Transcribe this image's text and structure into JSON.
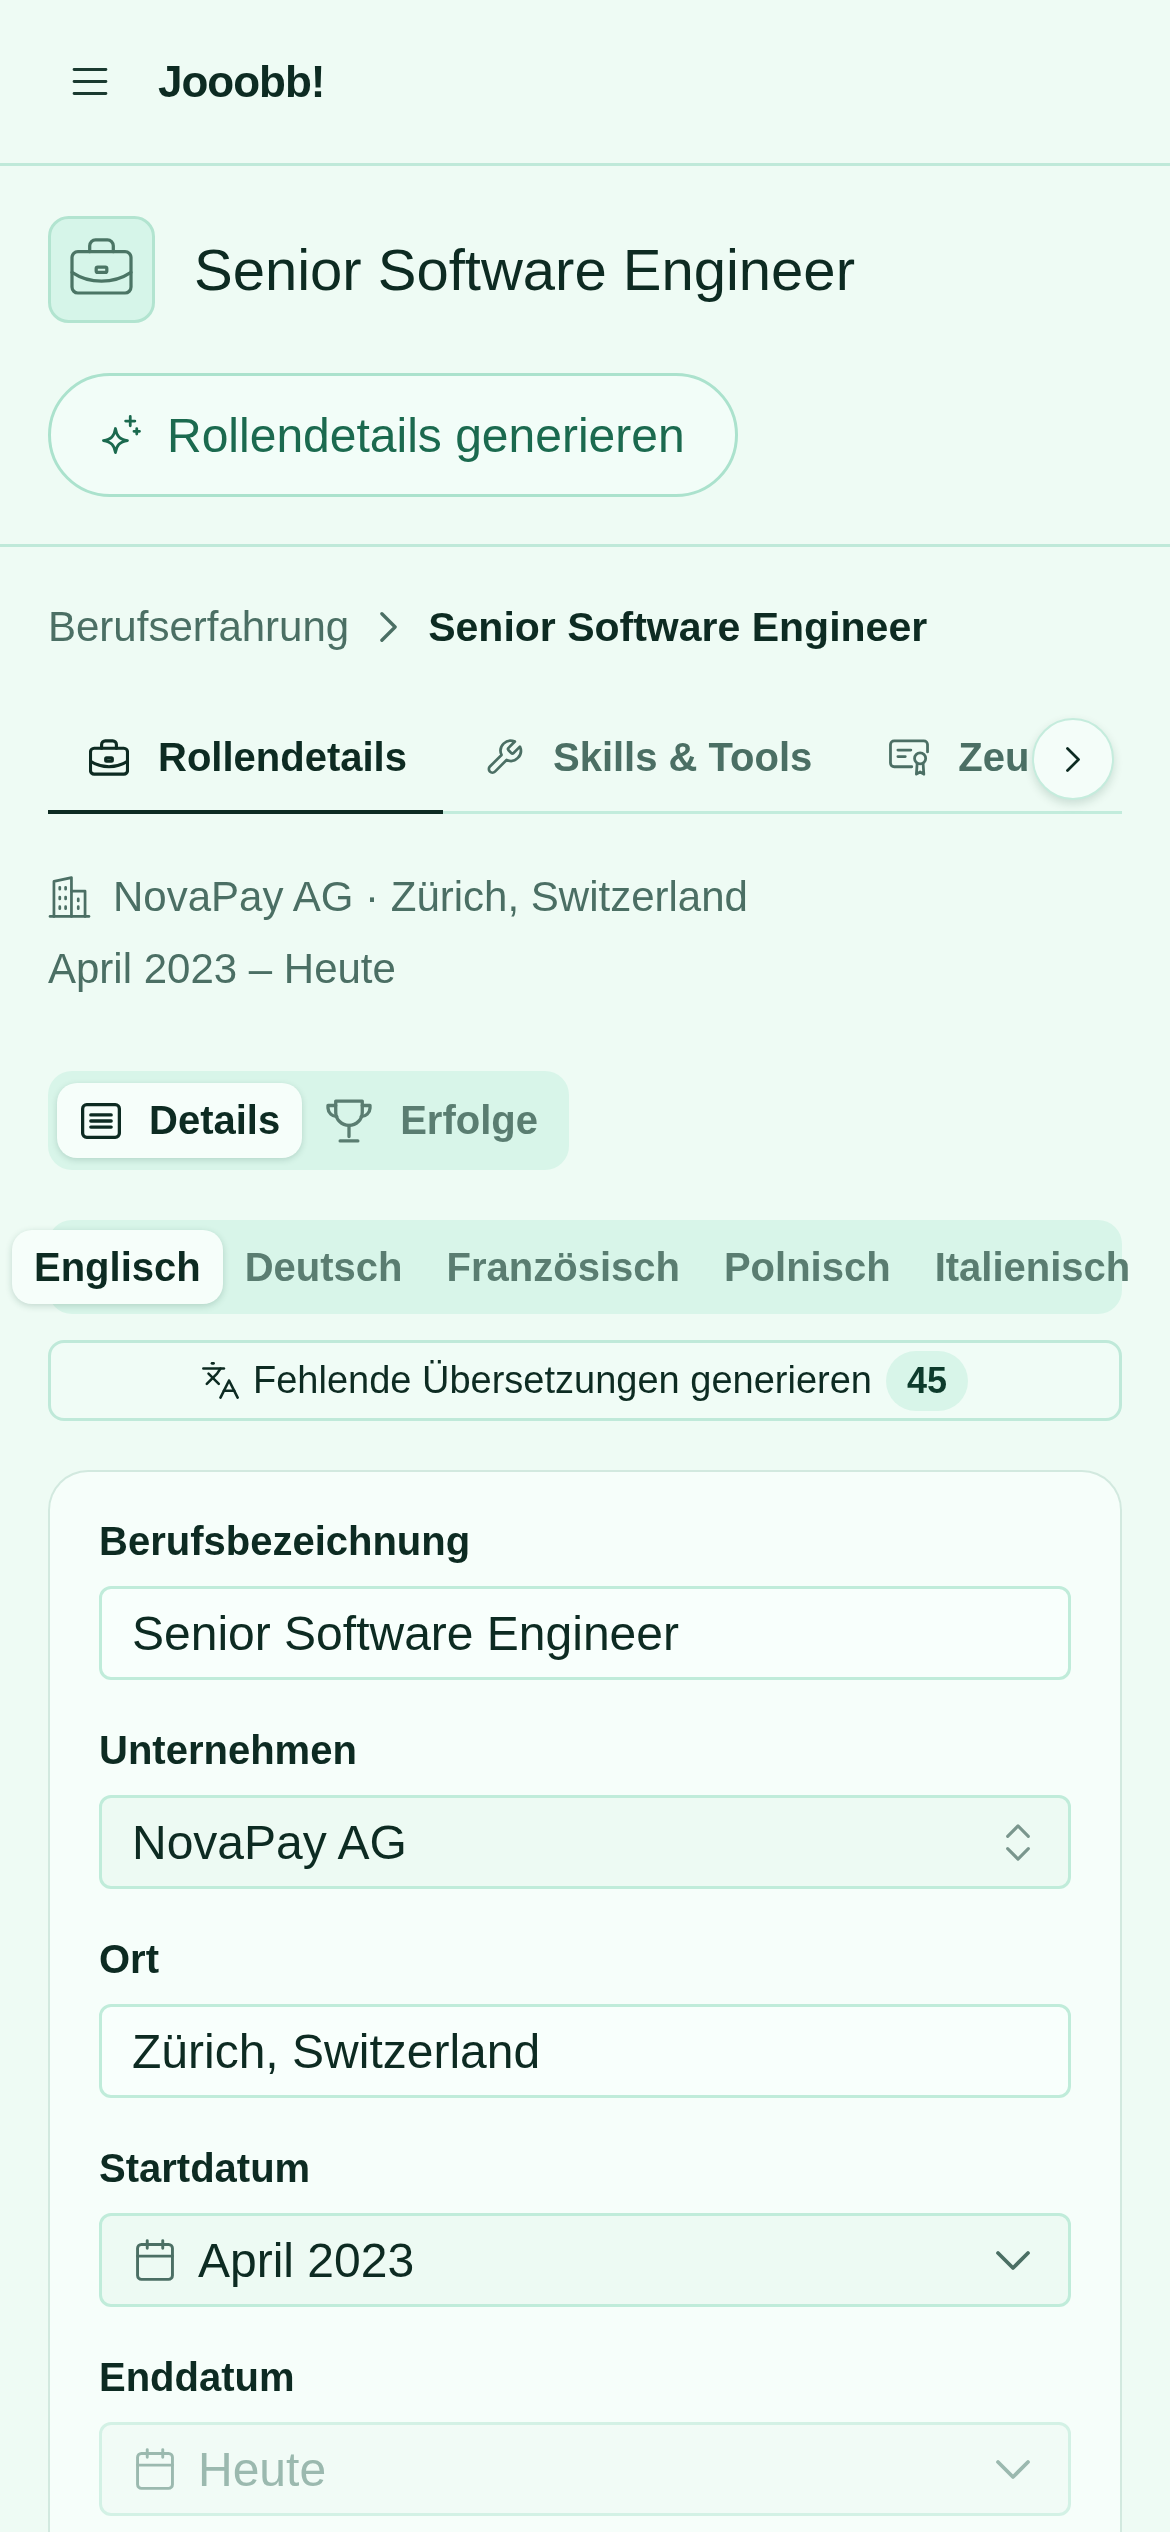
{
  "app_bar": {
    "title": "Jooobb!"
  },
  "role_header": {
    "title": "Senior Software Engineer",
    "generate_button": "Rollendetails generieren"
  },
  "breadcrumb": {
    "parent": "Berufserfahrung",
    "current": "Senior Software Engineer"
  },
  "tabs": [
    {
      "label": "Rollendetails",
      "selected": true
    },
    {
      "label": "Skills & Tools",
      "selected": false
    },
    {
      "label": "Zeu",
      "selected": false
    }
  ],
  "summary": {
    "company_location": "NovaPay AG · Zürich, Switzerland",
    "period": "April 2023 – Heute"
  },
  "view_toggle": [
    {
      "label": "Details",
      "selected": true
    },
    {
      "label": "Erfolge",
      "selected": false
    }
  ],
  "languages": [
    {
      "label": "Englisch",
      "selected": true
    },
    {
      "label": "Deutsch",
      "selected": false
    },
    {
      "label": "Französisch",
      "selected": false
    },
    {
      "label": "Polnisch",
      "selected": false
    },
    {
      "label": "Italienisch",
      "selected": false
    }
  ],
  "translate_button": {
    "label": "Fehlende Übersetzungen generieren",
    "count": "45"
  },
  "form": {
    "fields": [
      {
        "label": "Berufsbezeichnung",
        "kind": "text",
        "value": "Senior Software Engineer",
        "disabled": false
      },
      {
        "label": "Unternehmen",
        "kind": "combobox",
        "value": "NovaPay AG",
        "disabled": false
      },
      {
        "label": "Ort",
        "kind": "text",
        "value": "Zürich, Switzerland",
        "disabled": false
      },
      {
        "label": "Startdatum",
        "kind": "date",
        "value": "April 2023",
        "disabled": false
      },
      {
        "label": "Enddatum",
        "kind": "date",
        "value": "Heute",
        "disabled": true
      }
    ]
  }
}
